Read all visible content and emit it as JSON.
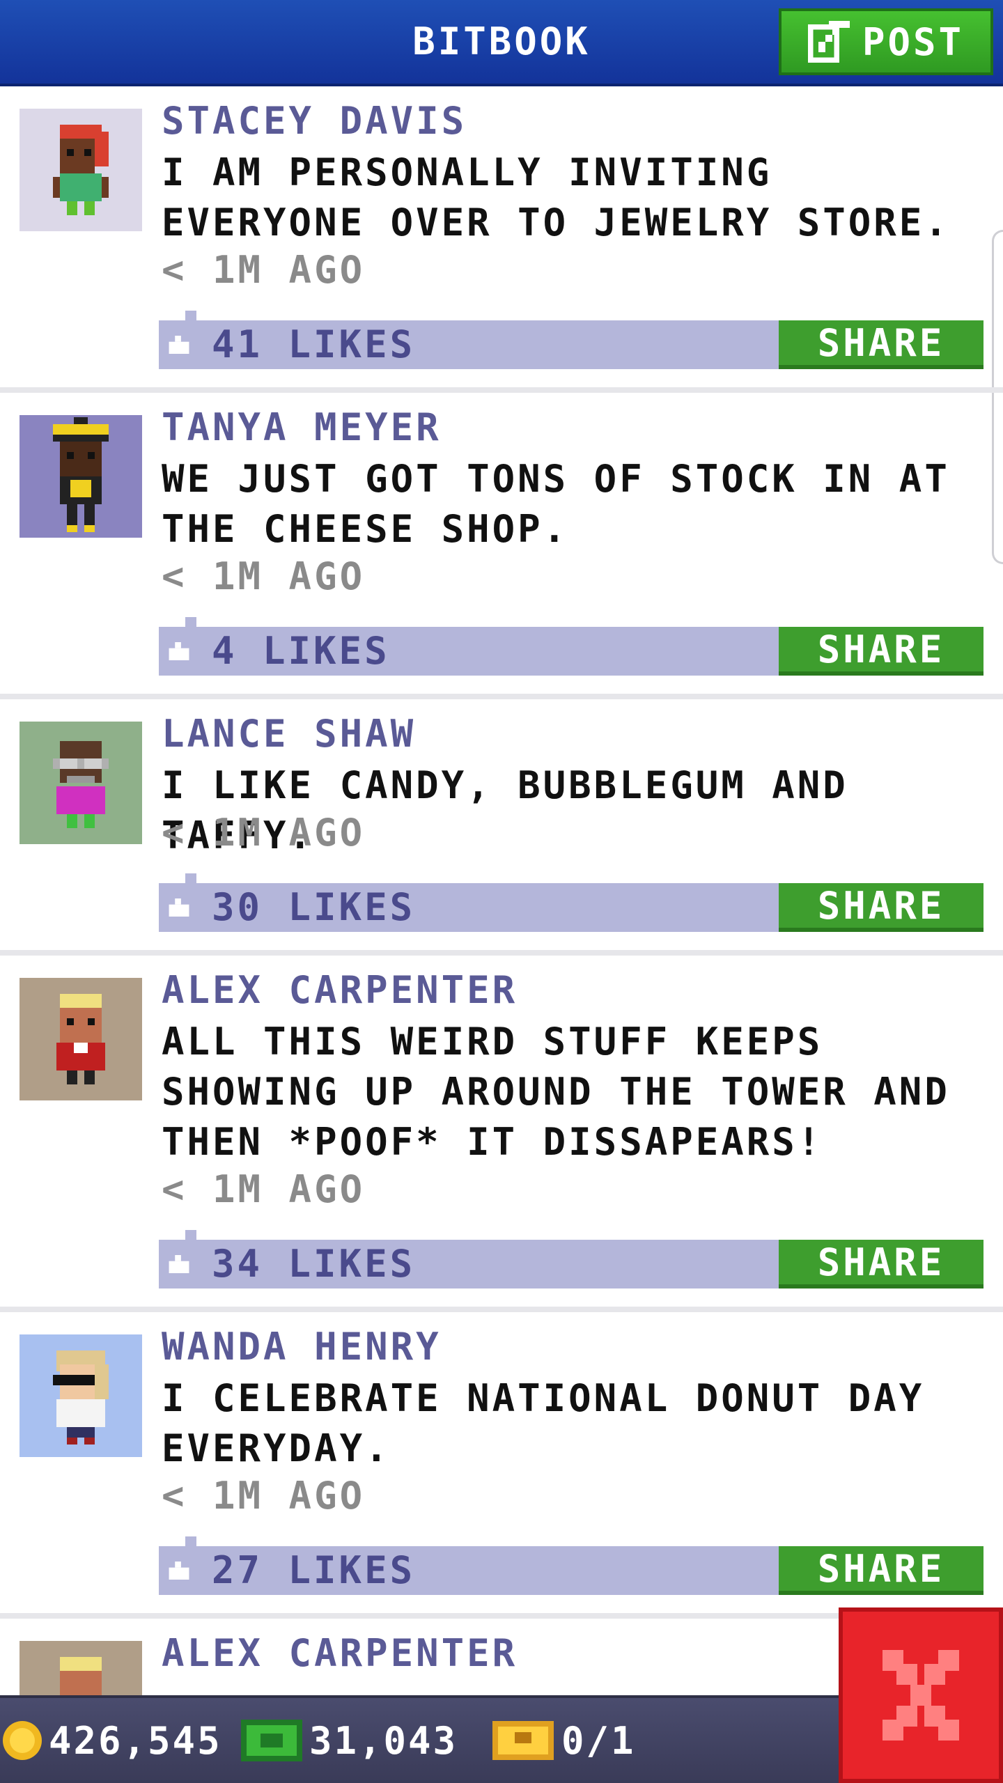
{
  "header": {
    "title": "BITBOOK",
    "post_label": "POST"
  },
  "posts": [
    {
      "name": "STACEY DAVIS",
      "text": "I AM PERSONALLY INVITING EVERYONE OVER TO JEWELRY STORE.",
      "time": "< 1M AGO",
      "likes": "41 LIKES",
      "share": "SHARE"
    },
    {
      "name": "TANYA MEYER",
      "text": "WE JUST GOT TONS OF STOCK IN AT THE CHEESE SHOP.",
      "time": "< 1M AGO",
      "likes": "4 LIKES",
      "share": "SHARE"
    },
    {
      "name": "LANCE SHAW",
      "text": "I LIKE CANDY, BUBBLEGUM AND TAFFY.",
      "time": "< 1M AGO",
      "likes": "30 LIKES",
      "share": "SHARE"
    },
    {
      "name": "ALEX CARPENTER",
      "text": "ALL THIS WEIRD STUFF KEEPS SHOWING UP AROUND THE TOWER AND THEN *POOF* IT DISSAPEARS!",
      "time": "< 1M AGO",
      "likes": "34 LIKES",
      "share": "SHARE"
    },
    {
      "name": "WANDA HENRY",
      "text": "I CELEBRATE NATIONAL DONUT DAY EVERYDAY.",
      "time": "< 1M AGO",
      "likes": "27 LIKES",
      "share": "SHARE"
    },
    {
      "name": "ALEX CARPENTER"
    }
  ],
  "status_bar": {
    "coins": "426,545",
    "bux": "31,043",
    "tickets": "0/1"
  },
  "colors": {
    "header_blue": "#1f4fb5",
    "post_green": "#3e9e2e",
    "likes_bar": "#b4b6da",
    "name_purple": "#5a5a96",
    "close_red": "#e8242a"
  },
  "icons": [
    "edit-icon",
    "like-icon",
    "coin-icon",
    "bux-icon",
    "ticket-icon",
    "close-icon"
  ]
}
